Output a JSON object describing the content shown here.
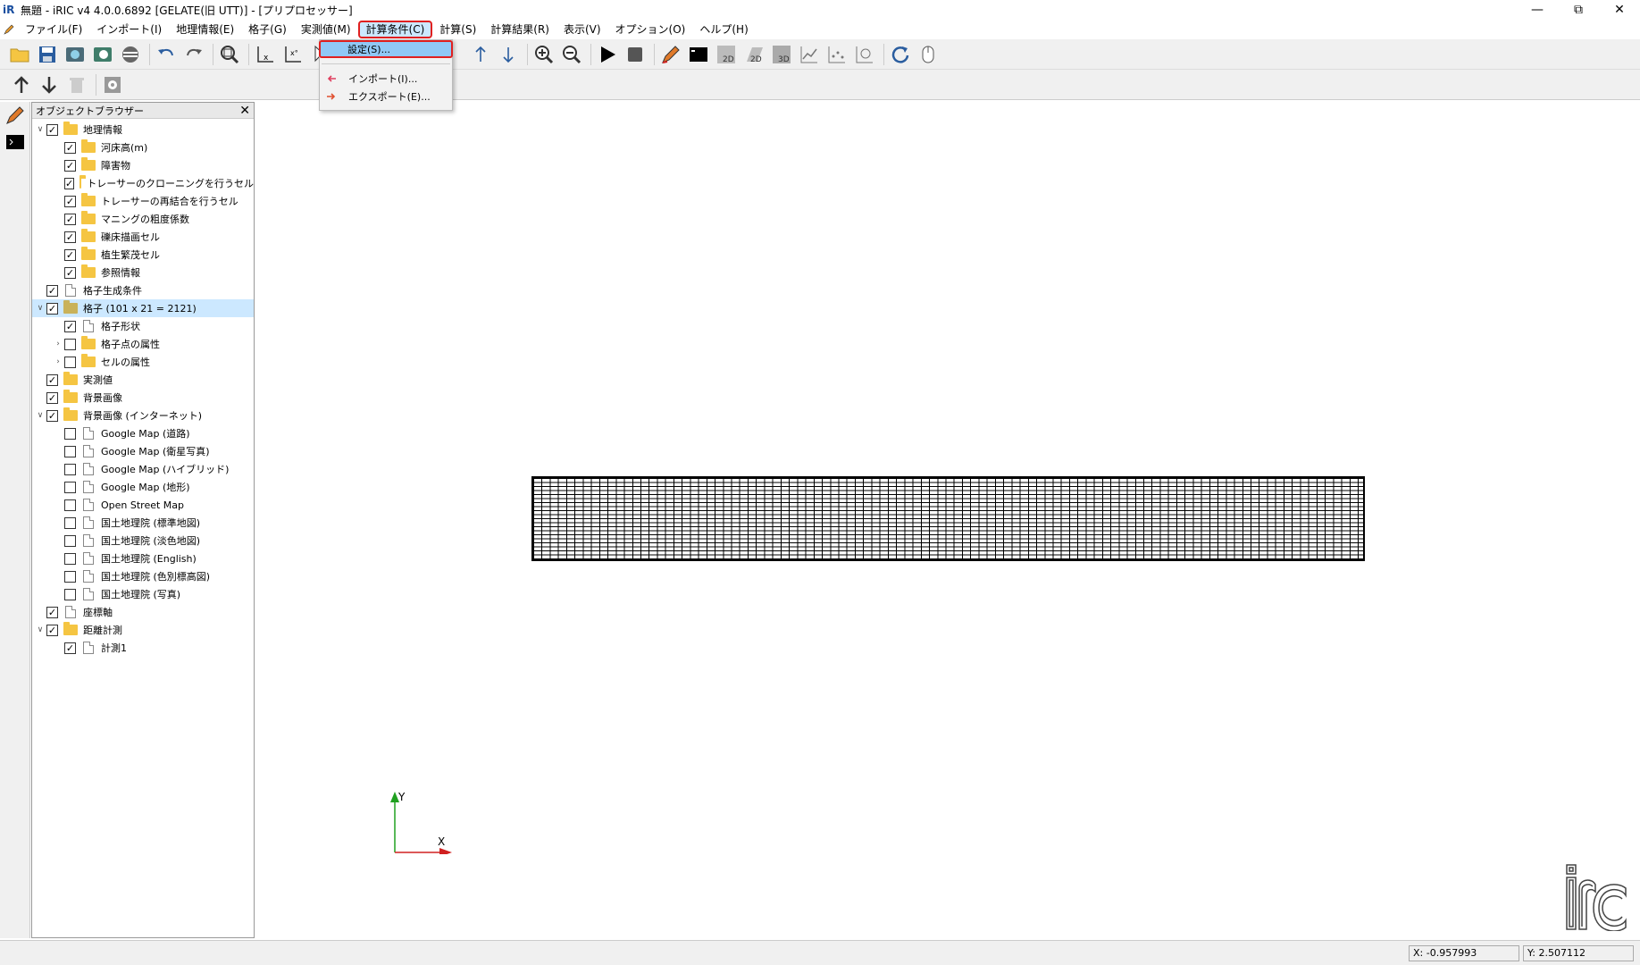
{
  "window": {
    "title": "無題 - iRIC v4 4.0.0.6892 [GELATE(旧 UTT)] - [プリプロセッサー]"
  },
  "menubar": {
    "items": [
      {
        "label": "ファイル(F)"
      },
      {
        "label": "インポート(I)"
      },
      {
        "label": "地理情報(E)"
      },
      {
        "label": "格子(G)"
      },
      {
        "label": "実測値(M)"
      },
      {
        "label": "計算条件(C)"
      },
      {
        "label": "計算(S)"
      },
      {
        "label": "計算結果(R)"
      },
      {
        "label": "表示(V)"
      },
      {
        "label": "オプション(O)"
      },
      {
        "label": "ヘルプ(H)"
      }
    ]
  },
  "calc_menu": {
    "items": [
      {
        "label": "設定(S)..."
      },
      {
        "label": "インポート(I)..."
      },
      {
        "label": "エクスポート(E)..."
      }
    ]
  },
  "object_browser": {
    "title": "オブジェクトブラウザー",
    "nodes": [
      {
        "label": "地理情報"
      },
      {
        "label": "河床高(m)"
      },
      {
        "label": "障害物"
      },
      {
        "label": "トレーサーのクローニングを行うセル"
      },
      {
        "label": "トレーサーの再結合を行うセル"
      },
      {
        "label": "マニングの粗度係数"
      },
      {
        "label": "礫床描画セル"
      },
      {
        "label": "植生繁茂セル"
      },
      {
        "label": "参照情報"
      },
      {
        "label": "格子生成条件"
      },
      {
        "label": "格子 (101 x 21 = 2121)"
      },
      {
        "label": "格子形状"
      },
      {
        "label": "格子点の属性"
      },
      {
        "label": "セルの属性"
      },
      {
        "label": "実測値"
      },
      {
        "label": "背景画像"
      },
      {
        "label": "背景画像 (インターネット)"
      },
      {
        "label": "Google Map (道路)"
      },
      {
        "label": "Google Map (衛星写真)"
      },
      {
        "label": "Google Map (ハイブリッド)"
      },
      {
        "label": "Google Map (地形)"
      },
      {
        "label": "Open Street Map"
      },
      {
        "label": "国土地理院 (標準地図)"
      },
      {
        "label": "国土地理院 (淡色地図)"
      },
      {
        "label": "国土地理院 (English)"
      },
      {
        "label": "国土地理院 (色別標高図)"
      },
      {
        "label": "国土地理院 (写真)"
      },
      {
        "label": "座標軸"
      },
      {
        "label": "距離計測"
      },
      {
        "label": "計測1"
      }
    ]
  },
  "axis": {
    "x_label": "X",
    "y_label": "Y"
  },
  "status": {
    "x_coord": "X: -0.957993",
    "y_coord": "Y: 2.507112"
  },
  "colors": {
    "accent": "#e02020",
    "selection": "#cce8ff",
    "folder": "#f5c542"
  }
}
